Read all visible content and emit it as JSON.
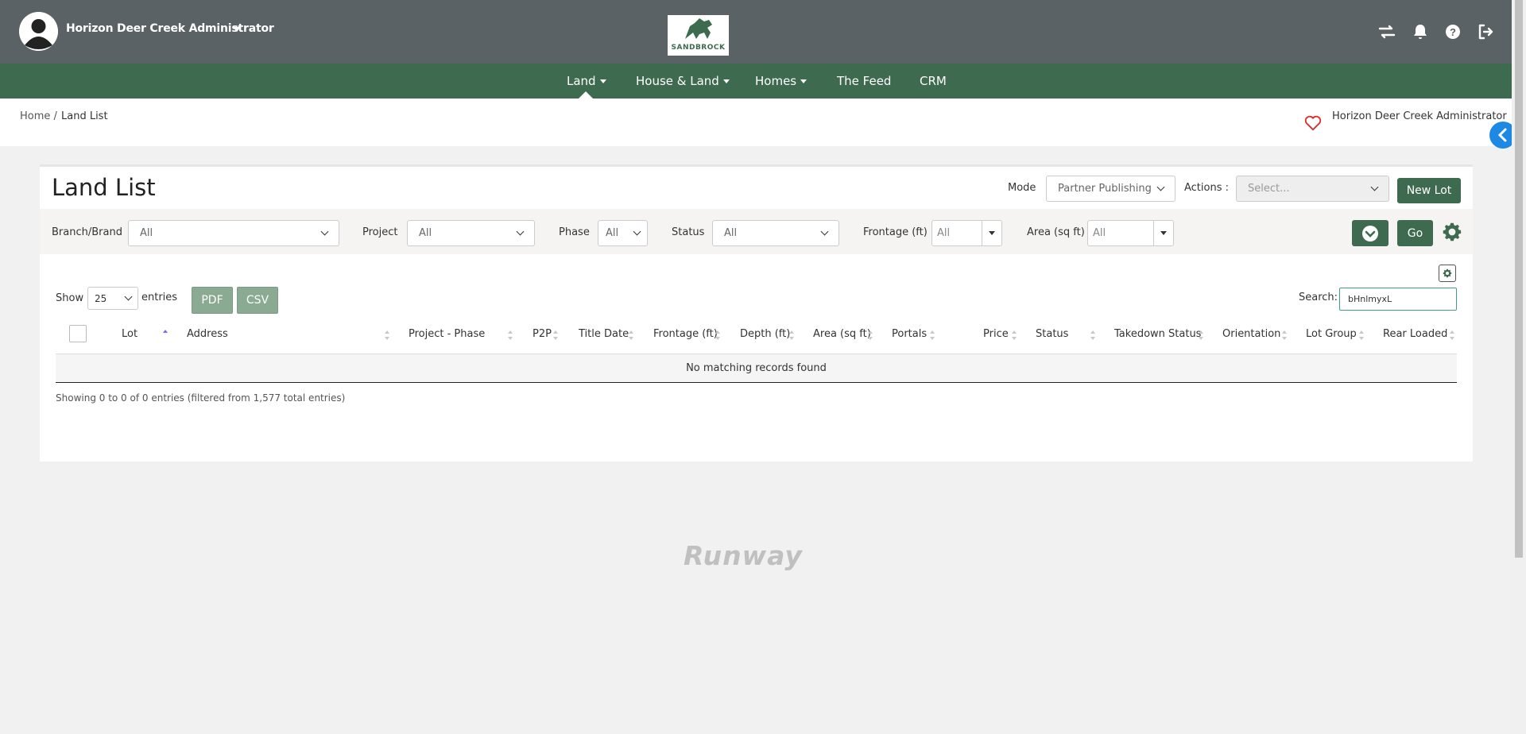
{
  "header": {
    "user_name": "Horizon Deer Creek Administrator",
    "logo_text": "SANDBROCK",
    "icons": [
      "swap-icon",
      "bell-icon",
      "help-icon",
      "logout-icon"
    ]
  },
  "nav": {
    "items": [
      {
        "label": "Land",
        "has_caret": true,
        "active": true
      },
      {
        "label": "House & Land",
        "has_caret": true
      },
      {
        "label": "Homes",
        "has_caret": true
      },
      {
        "label": "The Feed",
        "has_caret": false
      },
      {
        "label": "CRM",
        "has_caret": false
      }
    ]
  },
  "breadcrumb": {
    "home": "Home /",
    "current": "Land List",
    "user": "Horizon Deer Creek Administrator"
  },
  "page": {
    "title": "Land List",
    "mode_label": "Mode",
    "mode_value": "Partner Publishing",
    "actions_label": "Actions :",
    "actions_placeholder": "Select...",
    "new_lot_label": "New Lot"
  },
  "filters": {
    "branch_label": "Branch/Brand",
    "branch_value": "All",
    "project_label": "Project",
    "project_value": "All",
    "phase_label": "Phase",
    "phase_value": "All",
    "status_label": "Status",
    "status_value": "All",
    "frontage_label": "Frontage (ft)",
    "frontage_value": "All",
    "area_label": "Area (sq ft)",
    "area_value": "All",
    "go_label": "Go"
  },
  "table": {
    "show_label": "Show",
    "page_size": "25",
    "entries_label": "entries",
    "pdf_label": "PDF",
    "csv_label": "CSV",
    "search_label": "Search:",
    "search_value": "bHnlmyxL",
    "columns": [
      "Lot",
      "Address",
      "Project - Phase",
      "P2P",
      "Title Date",
      "Frontage (ft)",
      "Depth (ft)",
      "Area (sq ft)",
      "Portals",
      "Price",
      "Status",
      "Takedown Status",
      "Orientation",
      "Lot Group",
      "Rear Loaded"
    ],
    "empty_message": "No matching records found",
    "info": "Showing 0 to 0 of 0 entries (filtered from 1,577 total entries)"
  },
  "footer": {
    "brand": "Runway"
  },
  "colors": {
    "header_bg": "#5b6266",
    "nav_bg": "#3e6b4f",
    "accent_green": "#3e6b4f",
    "side_toggle": "#1e88e5"
  }
}
